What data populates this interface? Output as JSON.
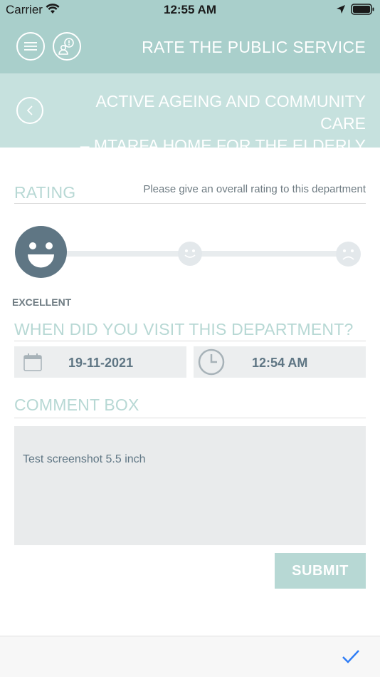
{
  "status_bar": {
    "carrier": "Carrier",
    "time": "12:55 AM"
  },
  "header": {
    "title": "RATE THE PUBLIC SERVICE"
  },
  "department": {
    "line1": "ACTIVE AGEING AND COMMUNITY CARE",
    "line2": "– MTARFA HOME FOR THE ELDERLY"
  },
  "rating": {
    "title": "RATING",
    "hint": "Please give an overall rating to this department",
    "selected_label": "EXCELLENT",
    "options": [
      "excellent",
      "neutral",
      "poor"
    ],
    "selected_index": 0
  },
  "visit": {
    "title": "WHEN DID YOU VISIT THIS DEPARTMENT?",
    "date": "19-11-2021",
    "time": "12:54 AM"
  },
  "comment": {
    "title": "COMMENT BOX",
    "value": "Test screenshot 5.5 inch"
  },
  "submit_label": "SUBMIT",
  "colors": {
    "header_bg": "#a9cfcb",
    "dept_bg": "#c6e1de",
    "accent_text": "#b7d8d4",
    "face_active": "#5f7684",
    "check_blue": "#2d7cf6"
  }
}
